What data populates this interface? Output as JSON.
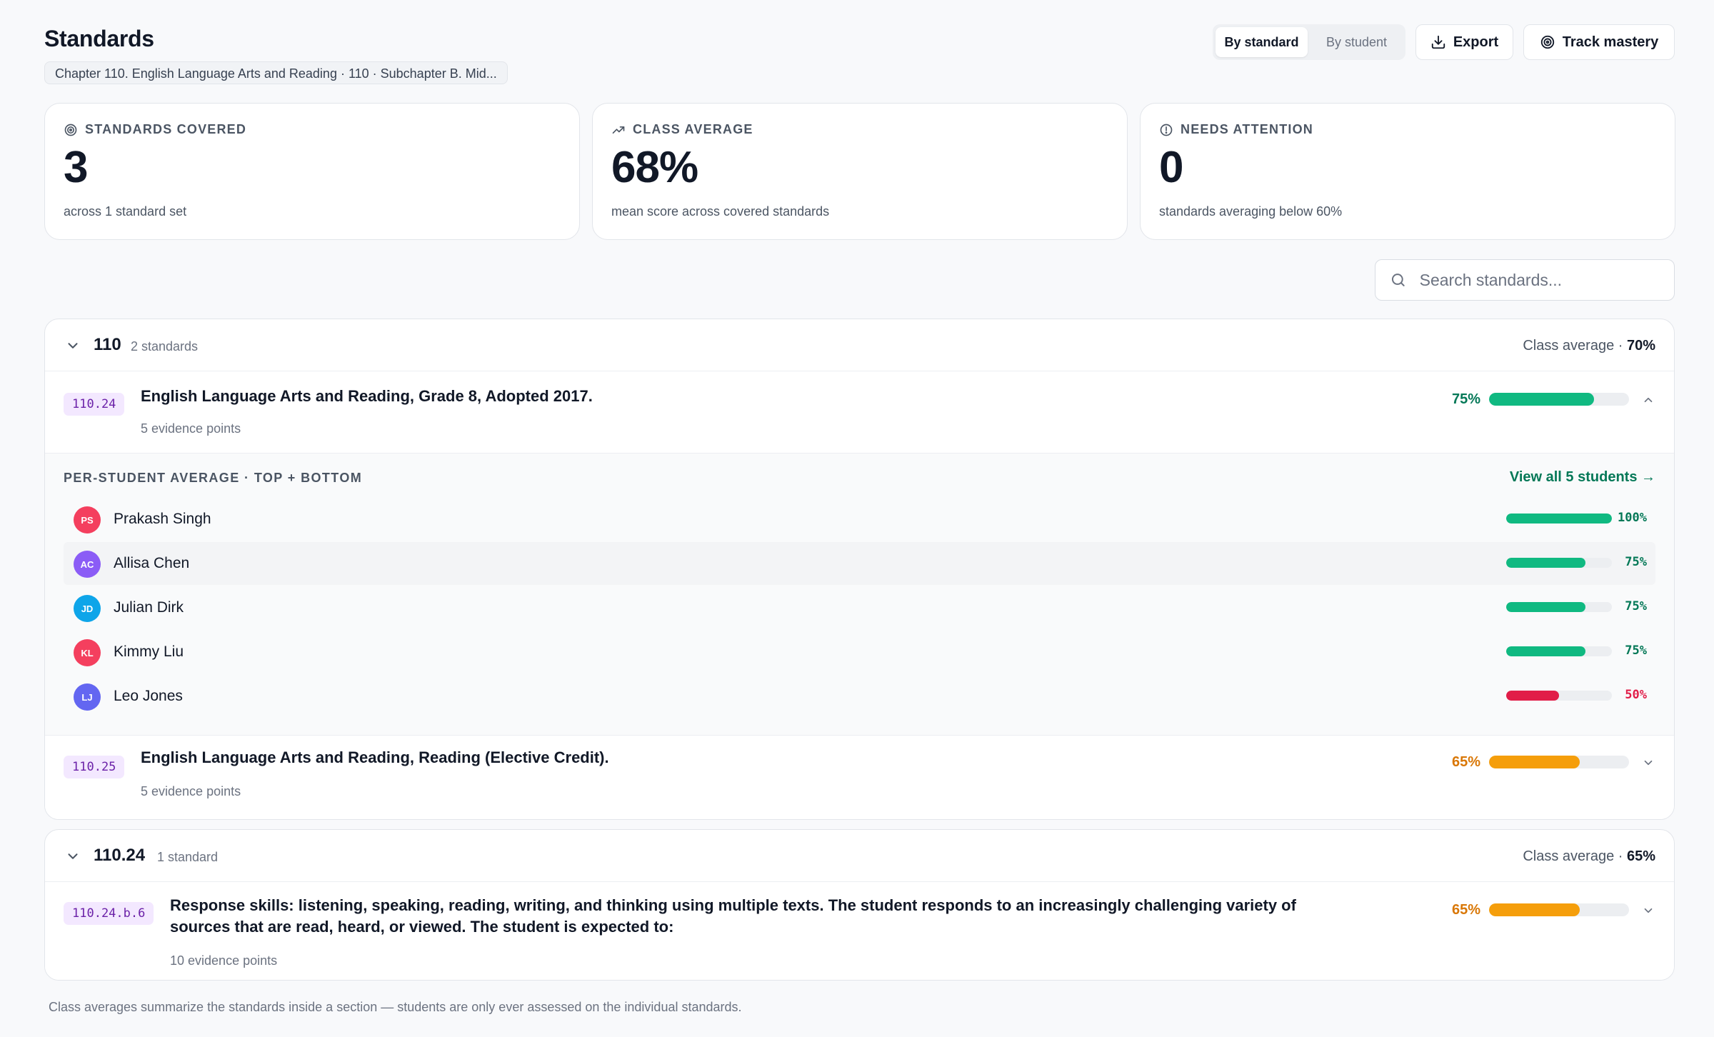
{
  "header": {
    "title": "Standards",
    "breadcrumb": "Chapter 110. English Language Arts and Reading · 110 · Subchapter B. Mid...",
    "view_toggle": [
      "By standard",
      "By student"
    ],
    "export_label": "Export",
    "track_label": "Track mastery"
  },
  "stats": [
    {
      "label": "STANDARDS COVERED",
      "value": "3",
      "sub": "across 1 standard set",
      "icon": "target-icon"
    },
    {
      "label": "CLASS AVERAGE",
      "value": "68%",
      "sub": "mean score across covered standards",
      "icon": "trending-up-icon"
    },
    {
      "label": "NEEDS ATTENTION",
      "value": "0",
      "sub": "standards averaging below 60%",
      "icon": "alert-circle-icon"
    }
  ],
  "search": {
    "placeholder": "Search standards..."
  },
  "sections": [
    {
      "name": "110",
      "count": "2 standards",
      "avg_label": "Class average · ",
      "avg_value": "70%",
      "standards": [
        {
          "code": "110.24",
          "title": "English Language Arts and Reading, Grade 8, Adopted 2017.",
          "evidence": "5 evidence points",
          "pct_label": "75%",
          "value": 75
        },
        {
          "code": "110.25",
          "title": "English Language Arts and Reading, Reading (Elective Credit).",
          "evidence": "5 evidence points",
          "pct_label": "65%",
          "value": 65
        }
      ]
    },
    {
      "name": "110.24",
      "count": "1 standard",
      "avg_label": "Class average · ",
      "avg_value": "65%",
      "standards": [
        {
          "code": "110.24.b.6",
          "title": "Response skills: listening, speaking, reading, writing, and thinking using multiple texts. The student responds to an increasingly challenging variety of sources that are read, heard, or viewed. The student is expected to:",
          "evidence": "10 evidence points",
          "pct_label": "65%",
          "value": 65
        }
      ]
    }
  ],
  "per_student": {
    "header": "PER-STUDENT AVERAGE · TOP + BOTTOM",
    "view_all": "View all 5 students →",
    "students": [
      {
        "initials": "PS",
        "name": "Prakash Singh",
        "pct_label": "100%",
        "value": 100,
        "avatar_color": "#f43f5e"
      },
      {
        "initials": "AC",
        "name": "Allisa Chen",
        "pct_label": "75%",
        "value": 75,
        "avatar_color": "#8b5cf6"
      },
      {
        "initials": "JD",
        "name": "Julian Dirk",
        "pct_label": "75%",
        "value": 75,
        "avatar_color": "#0ea5e9"
      },
      {
        "initials": "KL",
        "name": "Kimmy Liu",
        "pct_label": "75%",
        "value": 75,
        "avatar_color": "#f43f5e"
      },
      {
        "initials": "LJ",
        "name": "Leo Jones",
        "pct_label": "50%",
        "value": 50,
        "avatar_color": "#6366f1"
      }
    ]
  },
  "colors": {
    "good": "#10b981",
    "good_text": "#047857",
    "warn": "#f59e0b",
    "warn_text": "#d97706",
    "bad": "#e11d48"
  },
  "footer": "Class averages summarize the standards inside a section — students are only ever assessed on the individual standards."
}
